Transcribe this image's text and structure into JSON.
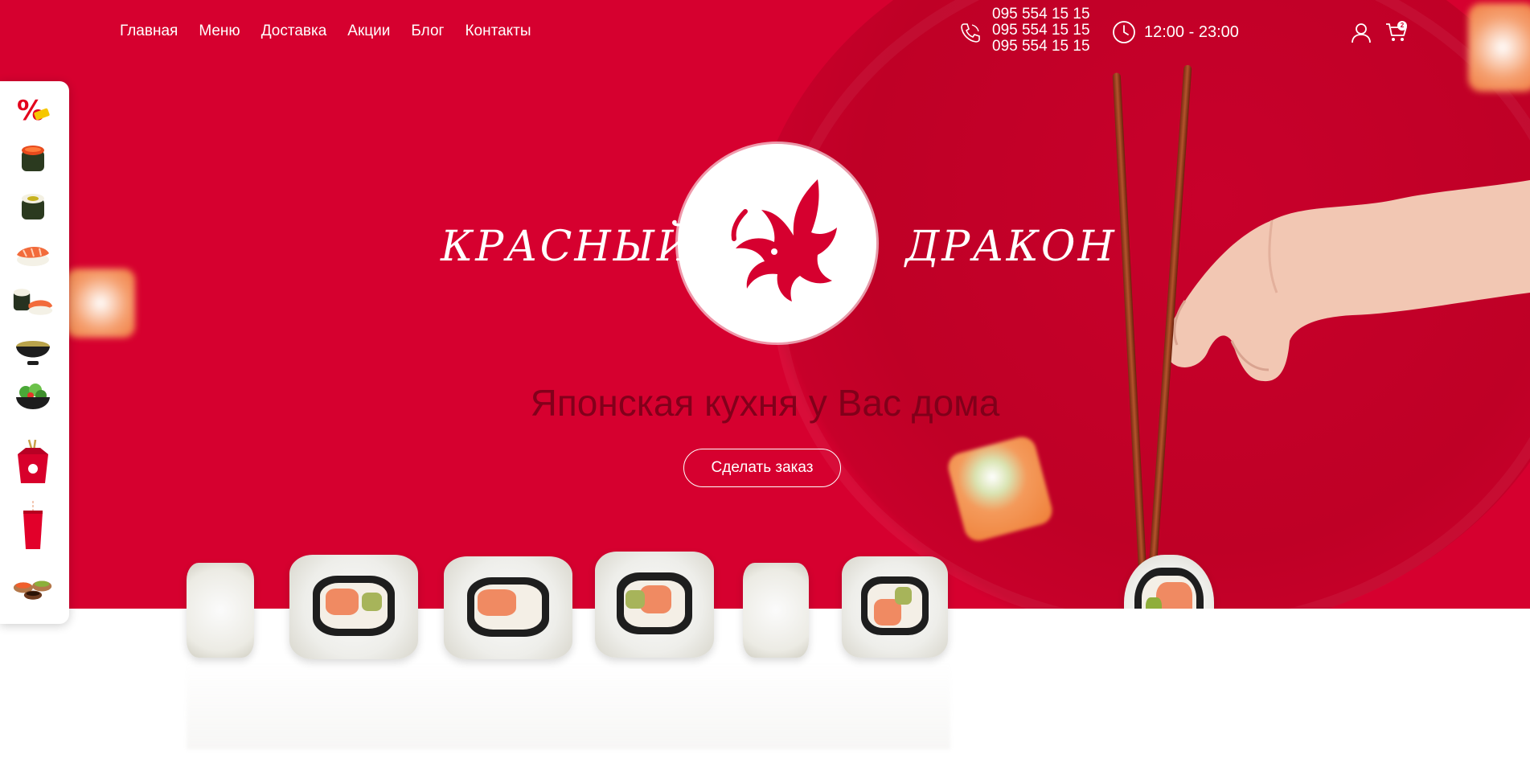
{
  "nav": {
    "items": [
      "Главная",
      "Меню",
      "Доставка",
      "Акции",
      "Блог",
      "Контакты"
    ]
  },
  "contact": {
    "phones": [
      "095 554 15 15",
      "095 554 15 15",
      "095 554 15 15"
    ],
    "hours": "12:00 - 23:00"
  },
  "cart": {
    "count": "2"
  },
  "brand": {
    "left": "КРАСНЫЙ",
    "right": "ДРАКОН",
    "tagline": "Японская кухня у Вас дома",
    "cta": "Сделать заказ"
  },
  "sidebar": {
    "items": [
      {
        "icon": "discount-icon"
      },
      {
        "icon": "gunkan-icon"
      },
      {
        "icon": "maki-roll-icon"
      },
      {
        "icon": "nigiri-icon"
      },
      {
        "icon": "sushi-set-icon"
      },
      {
        "icon": "soup-icon"
      },
      {
        "icon": "salad-icon"
      },
      {
        "icon": "wok-box-icon"
      },
      {
        "icon": "drink-icon"
      },
      {
        "icon": "sauces-icon"
      }
    ]
  },
  "colors": {
    "brand_red": "#d6002f",
    "white": "#ffffff"
  }
}
